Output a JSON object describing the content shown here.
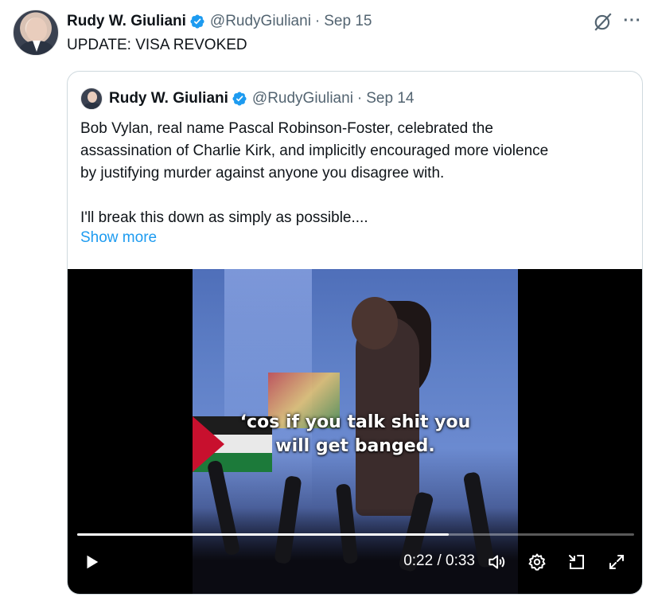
{
  "tweet": {
    "author_name": "Rudy W. Giuliani",
    "handle": "@RudyGiuliani",
    "separator": "·",
    "date": "Sep 15",
    "text": "UPDATE: VISA REVOKED",
    "more_label": "···"
  },
  "quote": {
    "author_name": "Rudy W. Giuliani",
    "handle": "@RudyGiuliani",
    "separator": "·",
    "date": "Sep 14",
    "text_lines": [
      "Bob Vylan, real name Pascal Robinson-Foster, celebrated the",
      "assassination of Charlie Kirk, and implicitly encouraged more violence",
      "by justifying murder against anyone you disagree with.",
      "I'll break this down as simply as possible...."
    ],
    "show_more": "Show more"
  },
  "video": {
    "subtitle_line1": "‘cos if you talk shit you",
    "subtitle_line2": "will get banged.",
    "time_display": "0:22 / 0:33",
    "progress": 0.6667
  },
  "colors": {
    "verified_blue": "#1d9bf0",
    "link_blue": "#1d9bf0",
    "muted_text": "#536471",
    "border": "#cfd9de"
  },
  "icons": [
    "verified-badge-icon",
    "grok-icon",
    "more-icon",
    "play-icon",
    "volume-icon",
    "settings-icon",
    "pip-icon",
    "fullscreen-icon"
  ]
}
